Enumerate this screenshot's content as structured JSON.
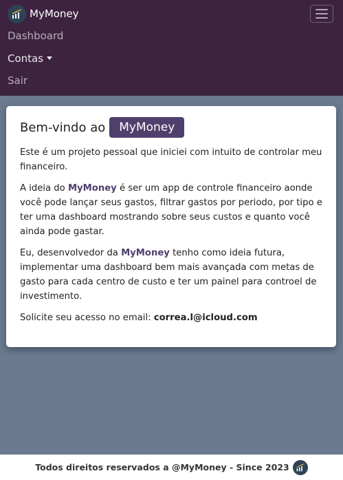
{
  "navbar": {
    "brand": "MyMoney",
    "logo_icon": "chart-logo-icon",
    "toggler_icon": "hamburger-menu-icon",
    "links": [
      {
        "label": "Dashboard"
      },
      {
        "label": "Contas"
      },
      {
        "label": "Sair"
      }
    ]
  },
  "card": {
    "title_prefix": "Bem-vindo ao",
    "title_badge": "MyMoney",
    "p1": "Este é um projeto pessoal que iniciei com intuito de controlar meu financeiro.",
    "p2_before": "A ideia do ",
    "p2_brand": "MyMoney",
    "p2_after": " é ser um app de controle financeiro aonde você pode lançar seus gastos, filtrar gastos por periodo, por tipo e ter uma dashboard mostrando sobre seus custos e quanto você ainda pode gastar.",
    "p3_before": "Eu, desenvolvedor da ",
    "p3_brand": "MyMoney",
    "p3_after": " tenho como ideia futura, implementar uma dashboard bem mais avançada com metas de gasto para cada centro de custo e ter um painel para controel de investimento.",
    "p4_before": "Solicite seu acesso no email: ",
    "p4_email": "correa.l@icloud.com"
  },
  "footer": {
    "text": "Todos direitos reservados a @MyMoney - Since 2023",
    "logo_icon": "chart-logo-icon"
  },
  "colors": {
    "navbar_bg": "#3d2340",
    "page_bg": "#6b7a91",
    "accent": "#4f3f6c",
    "logo_bg": "#2e4257"
  }
}
